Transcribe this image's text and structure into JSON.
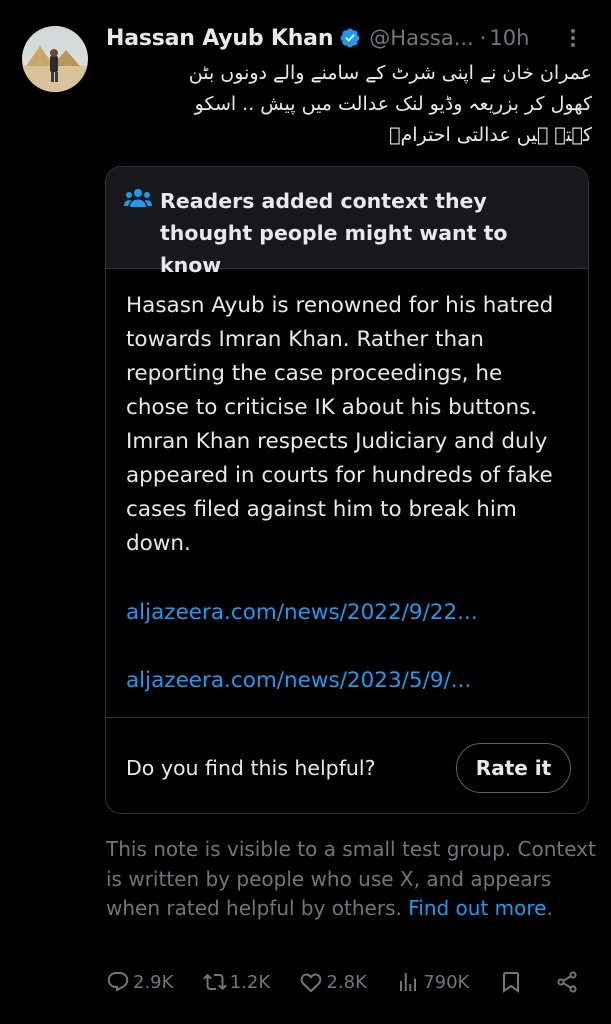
{
  "tweet": {
    "author_name": "Hassan Ayub Khan",
    "handle": "@Hassa...",
    "separator": "·",
    "time": "10h",
    "text_lines": [
      "عمران خان نے اپنی شرٹ کے سامنے والے دونوں بٹن",
      "کھول کر بزریعہ وڈیو لنک عدالت میں پیش .. اسکو",
      "کہتے ہیں عدالتی احترامؑ"
    ]
  },
  "note": {
    "title": "Readers added context they thought people might want to know",
    "body": "Hasasn Ayub is renowned for his hatred towards Imran Khan. Rather than reporting the case proceedings, he chose to criticise IK about his buttons. Imran Khan respects Judiciary and duly appeared in courts for hundreds of fake cases filed against him to break him down.",
    "link1": "aljazeera.com/news/2022/9/22...",
    "link2": "aljazeera.com/news/2023/5/9/...",
    "helpful_prompt": "Do you find this helpful?",
    "rate_label": "Rate it"
  },
  "footnote": {
    "text": "This note is visible to a small test group. Context is written by people who use X, and appears when rated helpful by others. ",
    "link": "Find out more",
    "end": "."
  },
  "actions": {
    "replies": "2.9K",
    "reposts": "1.2K",
    "likes": "2.8K",
    "views": "790K"
  },
  "colors": {
    "accent": "#1d9bf0",
    "muted": "#71767b",
    "text": "#e7e9ea",
    "background": "#000000"
  },
  "icons": [
    "more-icon",
    "verified-badge-icon",
    "people-icon",
    "reply-icon",
    "repost-icon",
    "like-icon",
    "views-icon",
    "bookmark-icon",
    "share-icon"
  ]
}
